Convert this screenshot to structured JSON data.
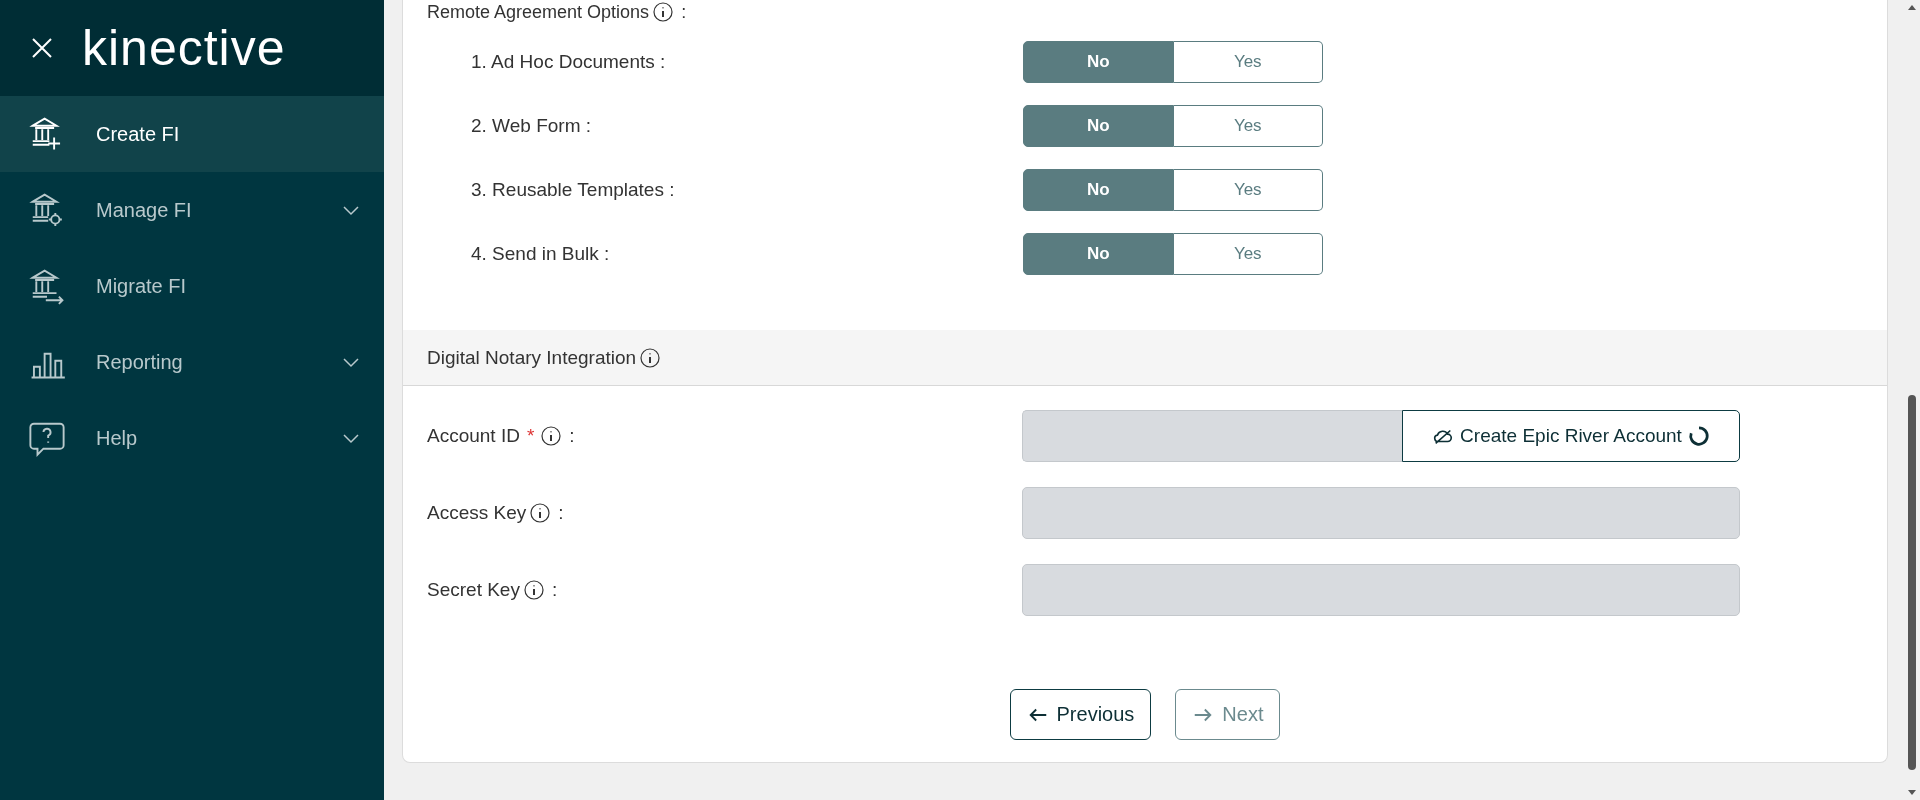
{
  "sidebar": {
    "logo": "kinective",
    "items": [
      {
        "label": "Create FI",
        "selected": true,
        "has_submenu": false
      },
      {
        "label": "Manage FI",
        "selected": false,
        "has_submenu": true
      },
      {
        "label": "Migrate FI",
        "selected": false,
        "has_submenu": false
      },
      {
        "label": "Reporting",
        "selected": false,
        "has_submenu": true
      },
      {
        "label": "Help",
        "selected": false,
        "has_submenu": true
      }
    ]
  },
  "remote_agreement": {
    "title": "Remote Agreement Options",
    "suffix": ":",
    "options": [
      {
        "label": "1. Ad Hoc Documents :",
        "choices": [
          {
            "label": "No",
            "selected": true
          },
          {
            "label": "Yes",
            "selected": false
          }
        ]
      },
      {
        "label": "2. Web Form :",
        "choices": [
          {
            "label": "No",
            "selected": true
          },
          {
            "label": "Yes",
            "selected": false
          }
        ]
      },
      {
        "label": "3. Reusable Templates :",
        "choices": [
          {
            "label": "No",
            "selected": true
          },
          {
            "label": "Yes",
            "selected": false
          }
        ]
      },
      {
        "label": "4. Send in Bulk :",
        "choices": [
          {
            "label": "No",
            "selected": true
          },
          {
            "label": "Yes",
            "selected": false
          }
        ]
      }
    ]
  },
  "digital_notary": {
    "title": "Digital Notary Integration",
    "fields": [
      {
        "label": "Account ID",
        "required_mark": "*",
        "suffix": ":",
        "disabled": true,
        "action": {
          "label": "Create Epic River Account",
          "loading": true
        }
      },
      {
        "label": "Access Key",
        "suffix": ":",
        "disabled": true
      },
      {
        "label": "Secret Key",
        "suffix": ":",
        "disabled": true
      }
    ]
  },
  "navigation": [
    {
      "label": "Previous",
      "kind": "back",
      "disabled": false
    },
    {
      "label": "Next",
      "kind": "forward",
      "disabled": true
    }
  ]
}
